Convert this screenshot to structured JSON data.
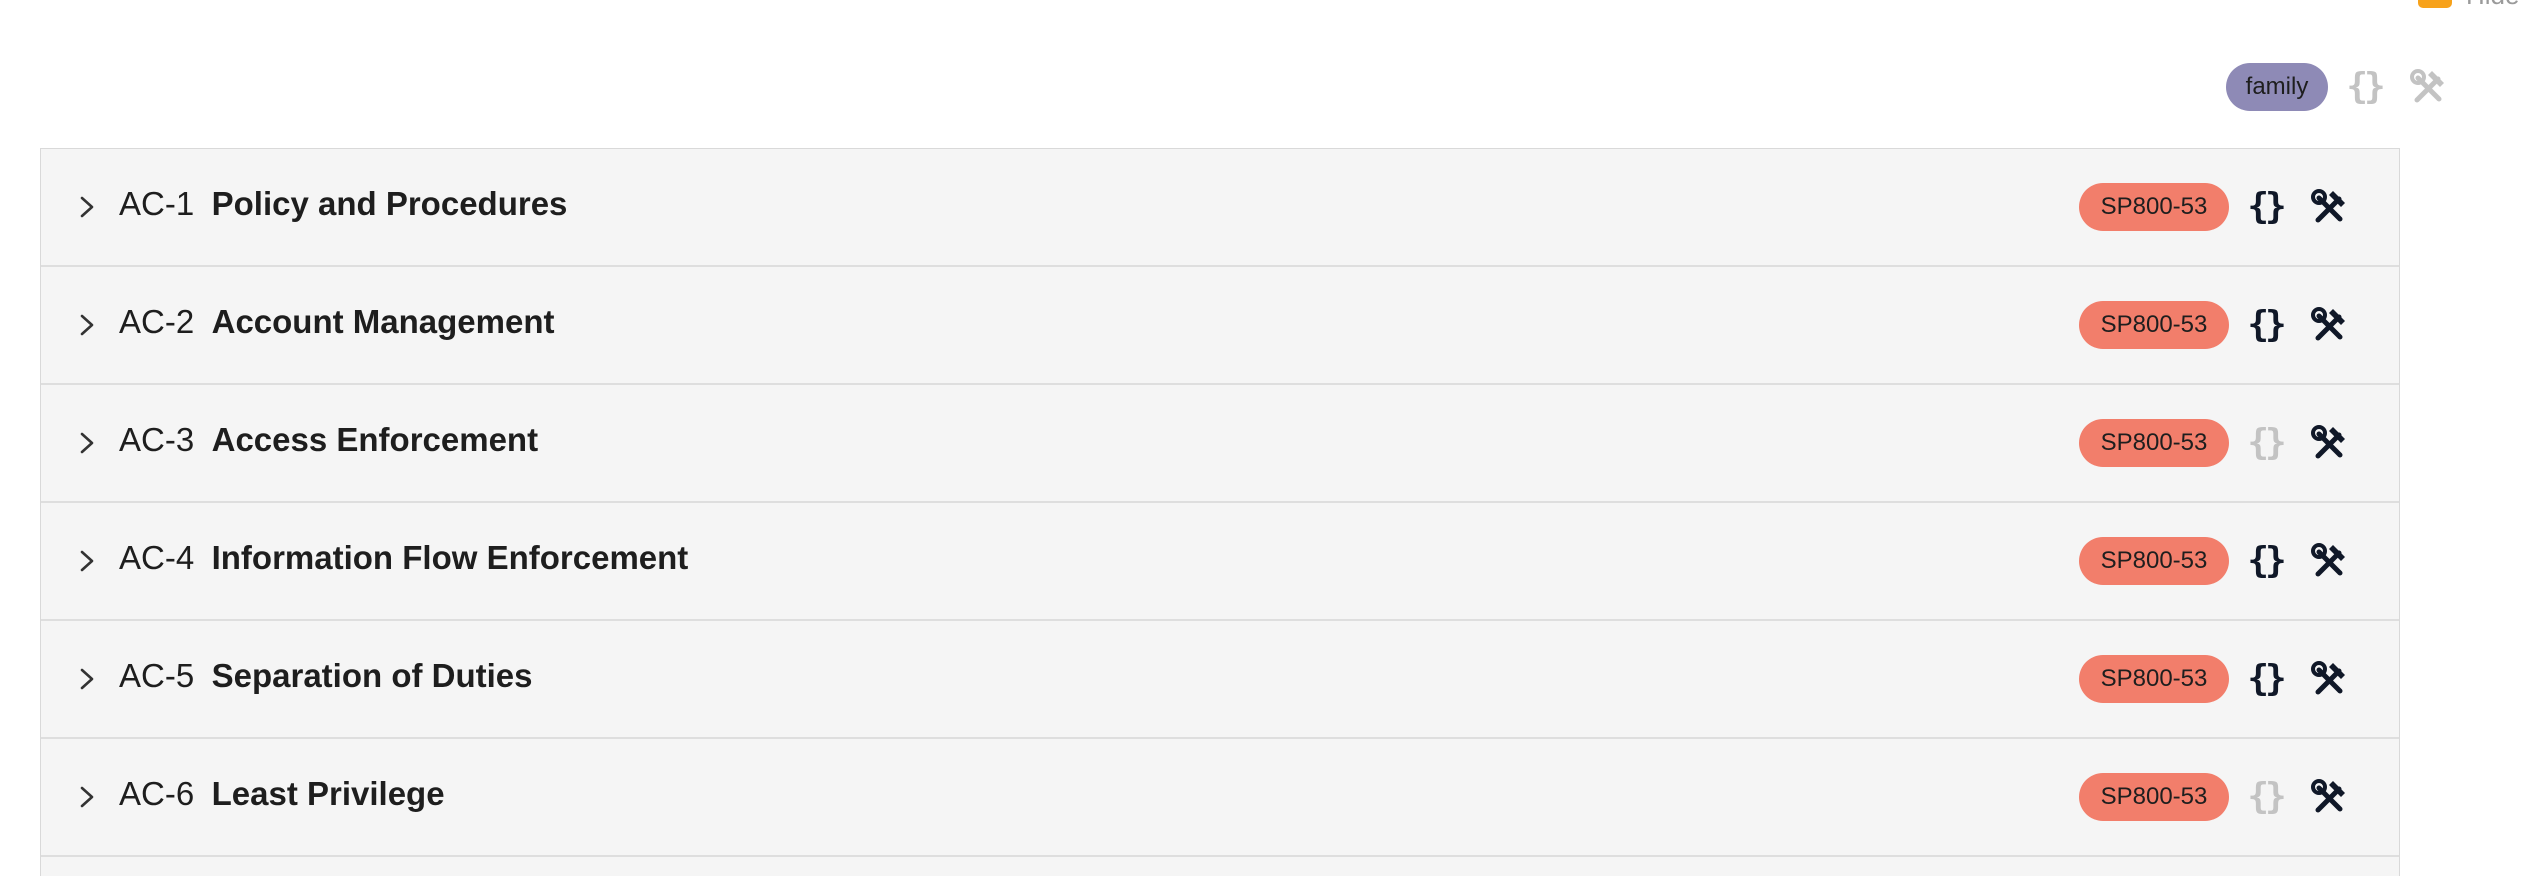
{
  "corner": {
    "label": "Hide"
  },
  "header": {
    "family_badge": "family",
    "json_icon": "braces-icon",
    "tools_icon": "tools-icon"
  },
  "colors": {
    "family_badge": "#8e8ab6",
    "source_badge": "#f27e6b",
    "icon_active": "#101828",
    "icon_dim": "#c3c3c3",
    "corner_checkbox": "#f7a21b"
  },
  "controls": [
    {
      "id": "AC-1",
      "name": "Policy and Procedures",
      "badge": "SP800-53",
      "json_active": true
    },
    {
      "id": "AC-2",
      "name": "Account Management",
      "badge": "SP800-53",
      "json_active": true
    },
    {
      "id": "AC-3",
      "name": "Access Enforcement",
      "badge": "SP800-53",
      "json_active": false
    },
    {
      "id": "AC-4",
      "name": "Information Flow Enforcement",
      "badge": "SP800-53",
      "json_active": true
    },
    {
      "id": "AC-5",
      "name": "Separation of Duties",
      "badge": "SP800-53",
      "json_active": true
    },
    {
      "id": "AC-6",
      "name": "Least Privilege",
      "badge": "SP800-53",
      "json_active": false
    }
  ]
}
